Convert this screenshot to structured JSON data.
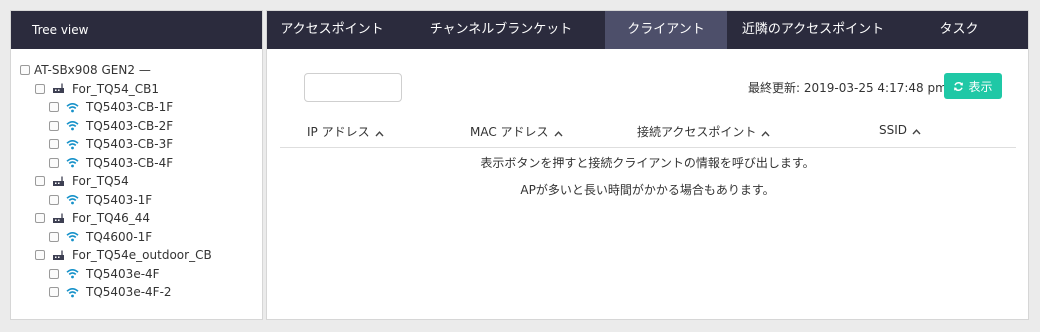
{
  "tree": {
    "header": "Tree view",
    "root": "AT-SBx908 GEN2 —",
    "groups": [
      {
        "label": "For_TQ54_CB1",
        "aps": [
          "TQ5403-CB-1F",
          "TQ5403-CB-2F",
          "TQ5403-CB-3F",
          "TQ5403-CB-4F"
        ]
      },
      {
        "label": "For_TQ54",
        "aps": [
          "TQ5403-1F"
        ]
      },
      {
        "label": "For_TQ46_44",
        "aps": [
          "TQ4600-1F"
        ]
      },
      {
        "label": "For_TQ54e_outdoor_CB",
        "aps": [
          "TQ5403e-4F",
          "TQ5403e-4F-2"
        ]
      }
    ]
  },
  "tabs": [
    "アクセスポイント",
    "チャンネルブランケット",
    "クライアント",
    "近隣のアクセスポイント",
    "タスク"
  ],
  "active_tab": "クライアント",
  "toolbar": {
    "search_value": "",
    "last_update": "最終更新: 2019-03-25 4:17:48 pm",
    "show_button": "表示"
  },
  "table": {
    "columns": [
      "IP アドレス",
      "MAC アドレス",
      "接続アクセスポイント",
      "SSID"
    ]
  },
  "messages": [
    "表示ボタンを押すと接続クライアントの情報を呼び出します。",
    "APが多いと長い時間がかかる場合もあります。"
  ],
  "colors": {
    "header_bg": "#2b2b3d",
    "active_tab": "#4d4f6a",
    "accent": "#1fc8a6",
    "wifi_icon": "#1591c9"
  },
  "icons": {
    "group": "switch-icon",
    "ap": "wifi-icon",
    "refresh": "refresh-icon",
    "sort": "chevron-up-icon"
  }
}
